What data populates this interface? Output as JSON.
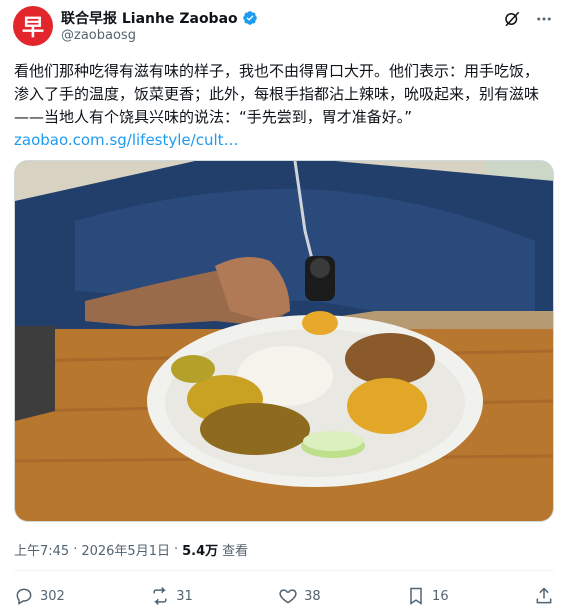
{
  "author": {
    "display_name": "联合早报 Lianhe Zaobao",
    "handle": "@zaobaosg",
    "avatar_glyph": "早",
    "avatar_color": "#e3262b",
    "verified": true,
    "verified_color": "#1d9bf0"
  },
  "header_icons": [
    "grok-icon",
    "more-icon"
  ],
  "post": {
    "text": "看他们那种吃得有滋有味的样子，我也不由得胃口大开。他们表示：用手吃饭，渗入了手的温度，饭菜更香；此外，每根手指都沾上辣味，吮吸起来，别有滋味——当地人有个饶具兴味的说法：“手先尝到，胃才准备好。”",
    "link": "zaobao.com.sg/lifestyle/cult…",
    "link_color": "#1d9bf0"
  },
  "media": {
    "icon": "photo-image"
  },
  "meta": {
    "time": "上午7:45",
    "date": "2026年5月1日",
    "separator": "·",
    "views_count": "5.4万",
    "views_label": "查看"
  },
  "actions": {
    "replies": "302",
    "reposts": "31",
    "likes": "38",
    "bookmarks": "16"
  }
}
